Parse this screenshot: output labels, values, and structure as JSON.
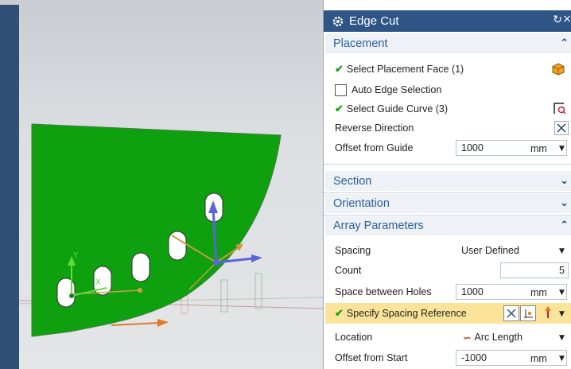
{
  "dialog": {
    "title": "Edge Cut",
    "sections": {
      "placement": "Placement",
      "section": "Section",
      "orientation": "Orientation",
      "array": "Array Parameters"
    },
    "placement": {
      "select_face": "Select Placement Face (1)",
      "auto_edge": "Auto Edge Selection",
      "select_guide": "Select Guide Curve (3)",
      "reverse": "Reverse Direction",
      "offset_label": "Offset from Guide",
      "offset_value": "1000",
      "offset_unit": "mm"
    },
    "array": {
      "spacing_label": "Spacing",
      "spacing_value": "User Defined",
      "count_label": "Count",
      "count_value": "5",
      "space_label": "Space between Holes",
      "space_value": "1000",
      "space_unit": "mm",
      "spec_ref": "Specify Spacing Reference",
      "location_label": "Location",
      "location_value": "Arc Length",
      "offset_start_label": "Offset from Start",
      "offset_start_value": "-1000",
      "offset_start_unit": "mm"
    }
  },
  "viewport": {
    "axis_x": "X",
    "axis_y": "Y"
  },
  "colors": {
    "plate": "#0fa00f",
    "titlebar": "#2e5586",
    "section_text": "#2b5f9e",
    "highlight": "#fbe49a"
  }
}
